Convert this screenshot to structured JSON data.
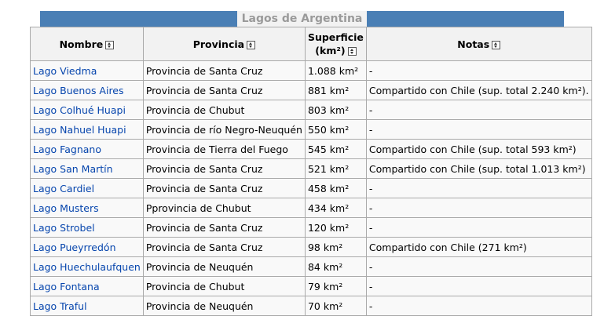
{
  "caption": "Lagos de Argentina",
  "headers": {
    "nombre": "Nombre",
    "provincia": "Provincia",
    "superficie_1": "Superficie",
    "superficie_2": "(km²)",
    "notas": "Notas"
  },
  "rows": [
    {
      "nombre": "Lago Viedma",
      "provincia": "Provincia de Santa Cruz",
      "superficie": "1.088 km²",
      "notas": "-"
    },
    {
      "nombre": "Lago Buenos Aires",
      "provincia": "Provincia de Santa Cruz",
      "superficie": "881 km²",
      "notas": "Compartido con Chile (sup. total 2.240 km²)."
    },
    {
      "nombre": "Lago Colhué Huapi",
      "provincia": "Provincia de Chubut",
      "superficie": "803 km²",
      "notas": "-"
    },
    {
      "nombre": "Lago Nahuel Huapi",
      "provincia": "Provincia de río Negro-Neuquén",
      "superficie": "550 km²",
      "notas": "-"
    },
    {
      "nombre": "Lago Fagnano",
      "provincia": "Provincia de Tierra del Fuego",
      "superficie": "545 km²",
      "notas": "Compartido con Chile (sup. total 593 km²)"
    },
    {
      "nombre": "Lago San Martín",
      "provincia": "Provincia de Santa Cruz",
      "superficie": "521 km²",
      "notas": "Compartido con Chile (sup. total 1.013 km²)"
    },
    {
      "nombre": "Lago Cardiel",
      "provincia": "Provincia de Santa Cruz",
      "superficie": "458 km²",
      "notas": "-"
    },
    {
      "nombre": "Lago Musters",
      "provincia": "Pprovincia de Chubut",
      "superficie": "434 km²",
      "notas": "-"
    },
    {
      "nombre": "Lago Strobel",
      "provincia": "Provincia de Santa Cruz",
      "superficie": "120 km²",
      "notas": "-"
    },
    {
      "nombre": "Lago Pueyrredón",
      "provincia": "Provincia de Santa Cruz",
      "superficie": "98 km²",
      "notas": "Compartido con Chile (271 km²)"
    },
    {
      "nombre": "Lago Huechulaufquen",
      "provincia": "Provincia de Neuquén",
      "superficie": "84 km²",
      "notas": "-"
    },
    {
      "nombre": "Lago Fontana",
      "provincia": "Provincia de Chubut",
      "superficie": "79 km²",
      "notas": "-"
    },
    {
      "nombre": "Lago Traful",
      "provincia": "Provincia de Neuquén",
      "superficie": "70 km²",
      "notas": "-"
    }
  ]
}
